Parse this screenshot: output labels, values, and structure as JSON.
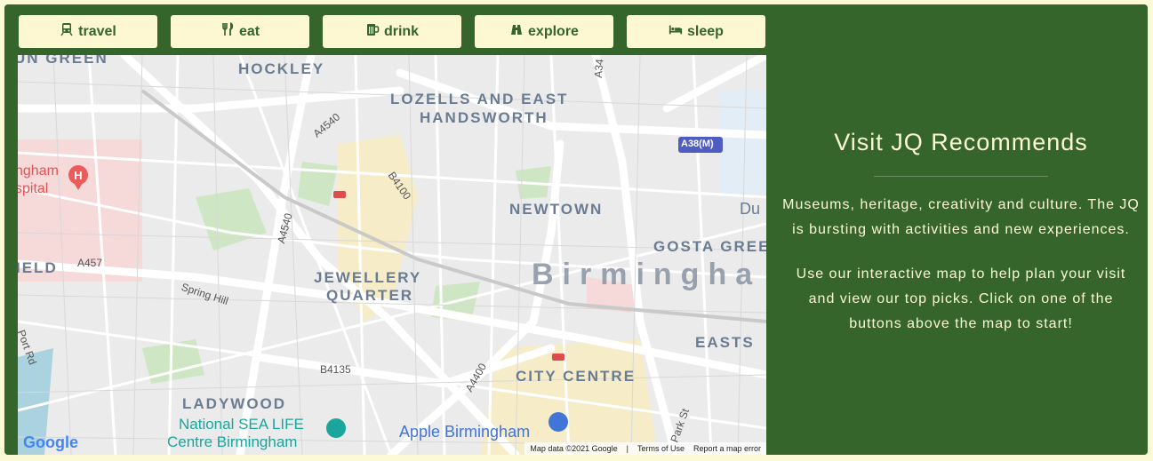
{
  "nav": {
    "buttons": [
      {
        "label": "travel",
        "icon": "train-icon"
      },
      {
        "label": "eat",
        "icon": "cutlery-icon"
      },
      {
        "label": "drink",
        "icon": "mug-icon"
      },
      {
        "label": "explore",
        "icon": "binoculars-icon"
      },
      {
        "label": "sleep",
        "icon": "bed-icon"
      }
    ]
  },
  "map": {
    "labels": {
      "hockley": "HOCKLEY",
      "lozells1": "LOZELLS AND EAST",
      "lozells2": "HANDSWORTH",
      "newtown": "NEWTOWN",
      "gosta": "GOSTA GREE",
      "jewellery1": "JEWELLERY",
      "jewellery2": "QUARTER",
      "birmingham": "Birmingha",
      "city_centre": "CITY CENTRE",
      "eastside": "EASTS",
      "ladywood": "LADYWOOD",
      "green": "UN GREEN",
      "field": "IELD",
      "du": "Du",
      "hospital1": "ngham",
      "hospital2": "spital",
      "sealife1": "National SEA LIFE",
      "sealife2": "Centre Birmingham",
      "apple": "Apple Birmingham",
      "spring_hill": "Spring Hill",
      "port_rd": "Port Rd",
      "park_st": "Park St",
      "a4540a": "A4540",
      "a4540b": "A4540",
      "b4100": "B4100",
      "a457": "A457",
      "b4135": "B4135",
      "a4400": "A4400",
      "a34": "A34",
      "a38m": "A38(M)"
    },
    "google_logo": "Google",
    "footer": {
      "data": "Map data ©2021 Google",
      "sep": "|",
      "terms": "Terms of Use",
      "report": "Report a map error"
    }
  },
  "sidebar": {
    "title": "Visit JQ Recommends",
    "paragraph1": "Museums, heritage, creativity and culture. The JQ is bursting with activities and new experiences.",
    "paragraph2": "Use our interactive map to help plan your visit and view our top picks. Click on one of the buttons above the map to start!"
  },
  "colors": {
    "panel": "#35652b",
    "button_bg": "#fdf8d2",
    "page_bg": "#fcf9d6"
  }
}
